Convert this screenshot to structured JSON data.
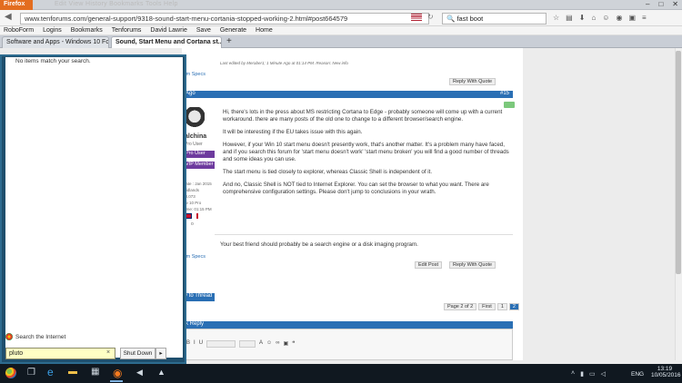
{
  "browser": {
    "app_button": "Firefox",
    "menu": "Edit View History Bookmarks Tools Help",
    "url": "www.tenforums.com/general-support/9318-sound-start-menu-cortania-stopped-working-2.html#post664579",
    "search_text": "fast boot",
    "bookmarks": [
      "RoboForm",
      "Logins",
      "Bookmarks",
      "Tenforums",
      "David Lawrie",
      "Save",
      "Generate",
      "Home"
    ],
    "tabs": [
      {
        "label": "Software and Apps - Windows 10 For..."
      },
      {
        "label": "Sound, Start Menu and Cortana st..."
      }
    ],
    "new_tab": "+"
  },
  "forum": {
    "top_edited": "Last edited by Meraber1; 1 Minute Ago at 01:14 PM. Reason: New info",
    "specs_top": "tem Specs",
    "reply_with_quote": "Reply With Quote",
    "edit_post": "Edit Post",
    "post_header_left": "Ago",
    "post_number": "#15",
    "username": "alchina",
    "rank": "Pro User",
    "badge1": "Pro User",
    "badge2": "VIP Member",
    "join_info": "Date : Jan 2015",
    "location": "Midlands",
    "posts": ": 3,073",
    "os": "ow 10 Pro",
    "local_time": "Time: 01:15 PM",
    "paragraphs": [
      "Hi, there's lots in the press about MS restricting Cortana to Edge - probably someone will come up with a current workaround. there are many posts of the old one to change to a different browser/search engine.",
      "It will be interesting if the EU takes issue with this again.",
      "However, if your Win 10 start menu doesn't presently work, that's another matter. It's a problem many have faced, and if you search this forum for 'start menu doesn't work' 'start menu broken' you will find a good number of threads and some ideas you can use.",
      "The start menu is tied closely to explorer, whereas Classic Shell is independent of it.",
      "And no, Classic Shell is NOT tied to Internet Explorer. You can set the browser to what you want. There are comprehensive configuration settings. Please don't jump to conclusions in your wrath."
    ],
    "signature": "Your best friend should probably be a search engine or a disk imaging program.",
    "specs_bottom": "tem Specs",
    "to_thread": "y to Thread",
    "page_info": "Page 2 of 2",
    "first": "First",
    "page1": "1",
    "page2": "2",
    "quick_reply": "k Reply"
  },
  "start_menu": {
    "no_items": "No items match your search.",
    "search_internet": "Search the Internet",
    "search_value": "pluto",
    "clear": "×",
    "shutdown": "Shut Down",
    "arrow": "▸"
  },
  "taskbar": {
    "lang": "ENG",
    "time": "13:19",
    "date": "10/05/2016"
  }
}
